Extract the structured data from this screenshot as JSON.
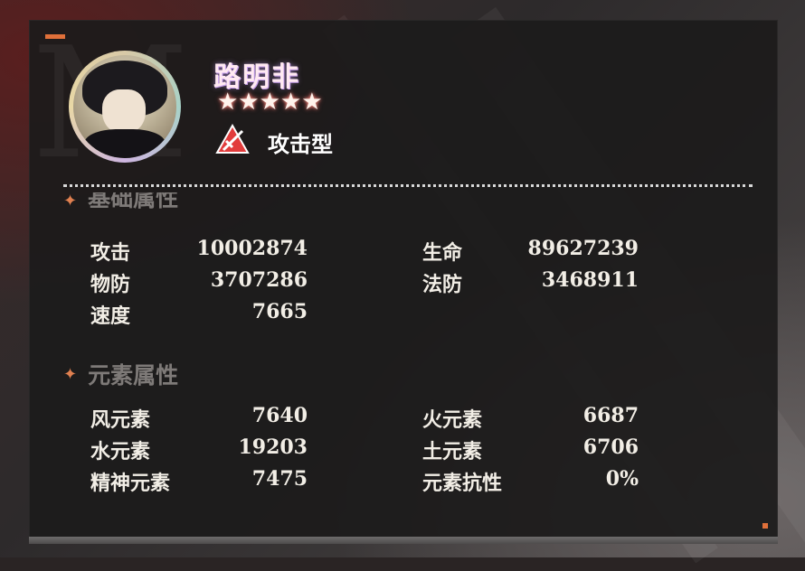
{
  "character": {
    "name": "路明非",
    "stars": "★★★★★",
    "role": "攻击型",
    "watermark": "M"
  },
  "base_section": {
    "title": "基础属性",
    "stats": [
      {
        "label": "攻击",
        "value": "10002874"
      },
      {
        "label": "生命",
        "value": "89627239"
      },
      {
        "label": "物防",
        "value": "3707286"
      },
      {
        "label": "法防",
        "value": "3468911"
      },
      {
        "label": "速度",
        "value": "7665"
      }
    ]
  },
  "element_section": {
    "title": "元素属性",
    "stats": [
      {
        "label": "风元素",
        "value": "7640"
      },
      {
        "label": "火元素",
        "value": "6687"
      },
      {
        "label": "水元素",
        "value": "19203"
      },
      {
        "label": "土元素",
        "value": "6706"
      },
      {
        "label": "精神元素",
        "value": "7475"
      },
      {
        "label": "元素抗性",
        "value": "0%"
      }
    ]
  },
  "colors": {
    "accent": "#e0703a",
    "panel": "#1c1b1b",
    "role_icon": "#e23c3c"
  },
  "icons": {
    "role": "attack-sword-icon",
    "section": "sparkle-icon"
  }
}
